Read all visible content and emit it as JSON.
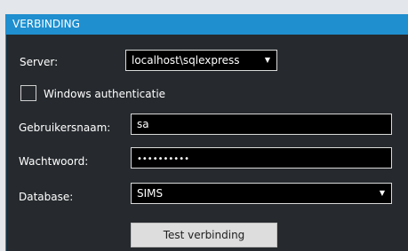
{
  "panel": {
    "title": "VERBINDING"
  },
  "server": {
    "label": "Server:",
    "value": "localhost\\sqlexpress"
  },
  "windows_auth": {
    "label": "Windows authenticatie",
    "checked": false
  },
  "username": {
    "label": "Gebruikersnaam:",
    "value": "sa"
  },
  "password": {
    "label": "Wachtwoord:",
    "value": "••••••••••"
  },
  "database": {
    "label": "Database:",
    "value": "SIMS"
  },
  "test_button": {
    "label": "Test verbinding"
  },
  "icons": {
    "dropdown_arrow": "▼"
  },
  "colors": {
    "accent": "#1f8fcf",
    "panel_bg": "#262a2e",
    "field_bg": "#000000",
    "button_bg": "#dddddd"
  }
}
